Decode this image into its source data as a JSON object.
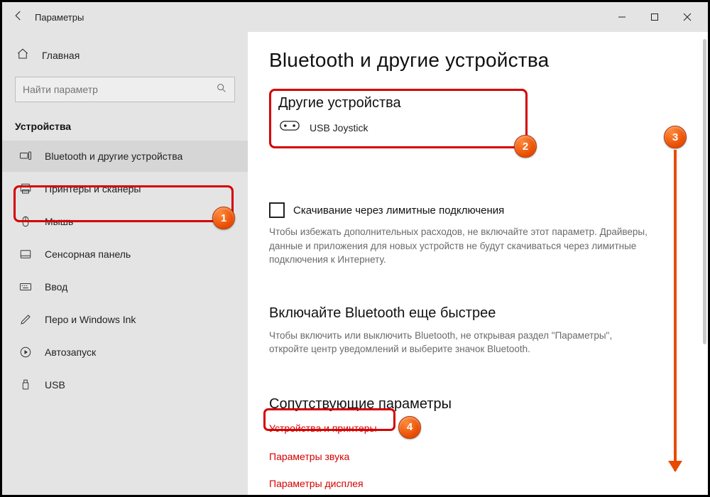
{
  "titlebar": {
    "title": "Параметры"
  },
  "sidebar": {
    "home": "Главная",
    "search_placeholder": "Найти параметр",
    "group": "Устройства",
    "items": [
      {
        "label": "Bluetooth и другие устройства",
        "icon": "keyboard",
        "selected": true
      },
      {
        "label": "Принтеры и сканеры",
        "icon": "printer"
      },
      {
        "label": "Мышь",
        "icon": "mouse"
      },
      {
        "label": "Сенсорная панель",
        "icon": "touchpad"
      },
      {
        "label": "Ввод",
        "icon": "keyboard2"
      },
      {
        "label": "Перо и Windows Ink",
        "icon": "pen"
      },
      {
        "label": "Автозапуск",
        "icon": "autoplay"
      },
      {
        "label": "USB",
        "icon": "usb"
      }
    ]
  },
  "main": {
    "title": "Bluetooth и другие устройства",
    "other_devices_title": "Другие устройства",
    "device_name": "USB  Joystick",
    "metered_label": "Скачивание через лимитные подключения",
    "metered_desc": "Чтобы избежать дополнительных расходов, не включайте этот параметр. Драйверы, данные и приложения для новых устройств не будут скачиваться через лимитные подключения к Интернету.",
    "bt_fast_title": "Включайте Bluetooth еще быстрее",
    "bt_fast_desc": "Чтобы включить или выключить Bluetooth, не открывая раздел \"Параметры\", откройте центр уведомлений и выберите значок Bluetooth.",
    "related_title": "Сопутствующие параметры",
    "links": [
      "Устройства и принтеры",
      "Параметры звука",
      "Параметры дисплея"
    ]
  },
  "badges": {
    "b1": "1",
    "b2": "2",
    "b3": "3",
    "b4": "4"
  }
}
